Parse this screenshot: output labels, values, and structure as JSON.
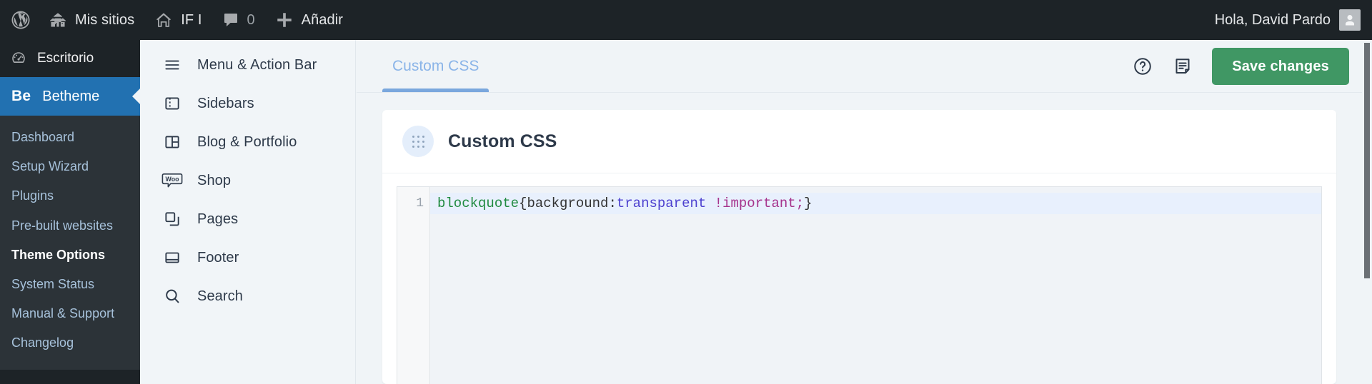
{
  "adminbar": {
    "wp_logo": "wordpress-logo-icon",
    "items": [
      {
        "icon": "sites-icon",
        "label": "Mis sitios"
      },
      {
        "icon": "home-icon",
        "label": "IF I"
      },
      {
        "icon": "comment-icon",
        "label": "0"
      },
      {
        "icon": "plus-icon",
        "label": "Añadir"
      }
    ],
    "greeting": "Hola, David Pardo",
    "avatar_icon": "user-avatar-icon"
  },
  "sidebar": {
    "dashboard_label": "Escritorio",
    "dashboard_icon": "dashboard-icon",
    "betheme": {
      "logo": "Be",
      "label": "Betheme"
    },
    "items": [
      {
        "label": "Dashboard",
        "current": false
      },
      {
        "label": "Setup Wizard",
        "current": false
      },
      {
        "label": "Plugins",
        "current": false
      },
      {
        "label": "Pre-built websites",
        "current": false
      },
      {
        "label": "Theme Options",
        "current": true
      },
      {
        "label": "System Status",
        "current": false
      },
      {
        "label": "Manual & Support",
        "current": false
      },
      {
        "label": "Changelog",
        "current": false
      }
    ]
  },
  "options_menu": {
    "items": [
      {
        "icon": "hamburger-icon",
        "label": "Menu & Action Bar"
      },
      {
        "icon": "sidebars-icon",
        "label": "Sidebars"
      },
      {
        "icon": "layout-icon",
        "label": "Blog & Portfolio"
      },
      {
        "icon": "woocommerce-icon",
        "label": "Shop"
      },
      {
        "icon": "pages-icon",
        "label": "Pages"
      },
      {
        "icon": "footer-icon",
        "label": "Footer"
      },
      {
        "icon": "search-icon",
        "label": "Search"
      }
    ]
  },
  "header": {
    "tabs": [
      {
        "label": "Custom CSS",
        "active": true
      }
    ],
    "help_icon": "help-circle-icon",
    "notes_icon": "notes-document-icon",
    "save_label": "Save changes"
  },
  "card": {
    "handle_icon": "drag-handle-dots-icon",
    "title": "Custom CSS"
  },
  "editor": {
    "line_number": "1",
    "code": {
      "selector": "blockquote",
      "open_brace": "{",
      "property": "background:",
      "value": "transparent",
      "important": " !important;",
      "close_brace": "}"
    }
  },
  "colors": {
    "adminbar_bg": "#1d2327",
    "betheme_blue": "#2271b1",
    "save_green": "#409764",
    "tab_blue": "#7aa7dd"
  }
}
